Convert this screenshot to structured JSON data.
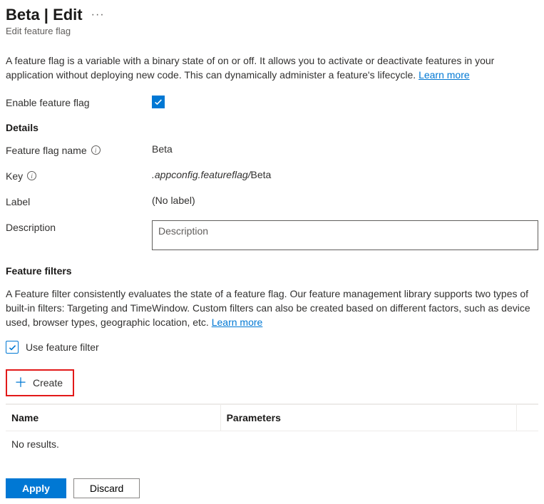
{
  "header": {
    "title": "Beta | Edit",
    "subtitle": "Edit feature flag"
  },
  "intro": {
    "text": "A feature flag is a variable with a binary state of on or off. It allows you to activate or deactivate features in your application without deploying new code. This can dynamically administer a feature's lifecycle. ",
    "learnMore": "Learn more"
  },
  "enable": {
    "label": "Enable feature flag",
    "checked": true
  },
  "details": {
    "sectionTitle": "Details",
    "nameLabel": "Feature flag name",
    "nameValue": "Beta",
    "keyLabel": "Key",
    "keyPrefix": ".appconfig.featureflag/",
    "keySuffix": "Beta",
    "labelLabel": "Label",
    "labelValue": "(No label)",
    "descLabel": "Description",
    "descPlaceholder": "Description",
    "descValue": ""
  },
  "filters": {
    "sectionTitle": "Feature filters",
    "intro": "A Feature filter consistently evaluates the state of a feature flag. Our feature management library supports two types of built-in filters: Targeting and TimeWindow. Custom filters can also be created based on different factors, such as device used, browser types, geographic location, etc. ",
    "learnMore": "Learn more",
    "useFilterLabel": "Use feature filter",
    "useFilterChecked": true,
    "createLabel": "Create",
    "table": {
      "colName": "Name",
      "colParams": "Parameters",
      "noResults": "No results."
    }
  },
  "footer": {
    "apply": "Apply",
    "discard": "Discard"
  }
}
